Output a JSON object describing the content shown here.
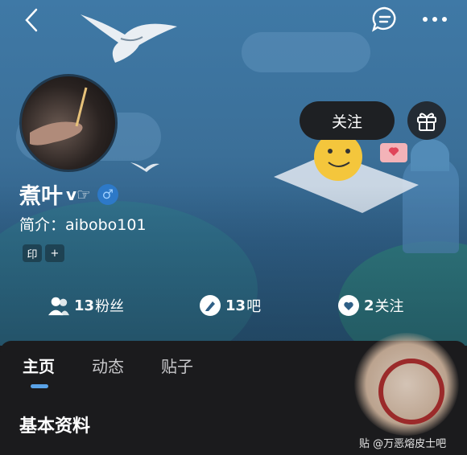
{
  "profile": {
    "name": "煮叶",
    "name_suffix": "v☞",
    "gender_symbol": "♂",
    "bio": "简介：aibobo101"
  },
  "buttons": {
    "follow": "关注"
  },
  "tags": [
    "印",
    "+"
  ],
  "stats": [
    {
      "icon": "fans-icon",
      "value": "13",
      "label": "粉丝"
    },
    {
      "icon": "bar-icon",
      "value": "13",
      "label": "吧"
    },
    {
      "icon": "heart-icon",
      "value": "2",
      "label": "关注"
    }
  ],
  "tabs": [
    "主页",
    "动态",
    "贴子"
  ],
  "section_title": "基本资料",
  "watermark": "贴 @万恶熔皮士吧",
  "colors": {
    "accent": "#5aa3e8",
    "gender_badge": "#2d79c8",
    "panel": "#1b1b1d"
  }
}
